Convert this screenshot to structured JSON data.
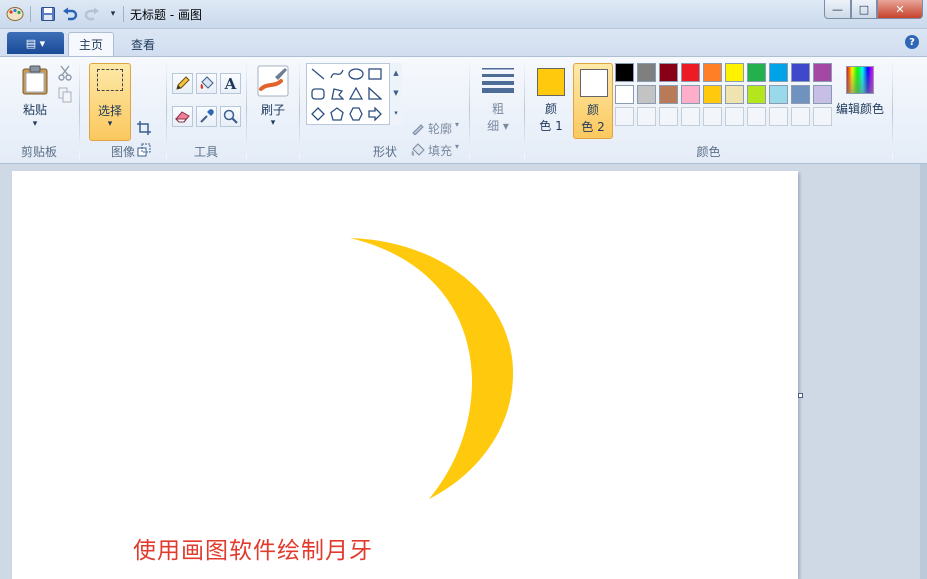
{
  "window": {
    "title": "无标题 - 画图",
    "controls": {
      "minimize": "—",
      "maximize": "□",
      "close": "✕"
    }
  },
  "quick_access": {
    "icons": [
      "paint-app-icon",
      "save-icon",
      "undo-icon",
      "redo-icon",
      "customize-dropdown-icon"
    ]
  },
  "tabs": {
    "app_menu": "▤ ▾",
    "home": "主页",
    "view": "查看",
    "help": "?"
  },
  "ribbon": {
    "clipboard": {
      "label": "剪贴板",
      "paste": "粘贴",
      "paste_arrow": "▾"
    },
    "image": {
      "label": "图像",
      "select": "选择",
      "select_arrow": "▾"
    },
    "tools": {
      "label": "工具"
    },
    "brushes": {
      "label": "刷子",
      "arrow": "▾"
    },
    "shapes": {
      "label": "形状",
      "outline": "轮廓",
      "fill": "填充"
    },
    "size": {
      "line1": "粗",
      "line2": "细 ▾"
    },
    "colors": {
      "label": "颜色",
      "color1_line1": "颜",
      "color1_line2": "色 1",
      "color2_line1": "颜",
      "color2_line2": "色 2",
      "color1_value": "#ffc90e",
      "color2_value": "#ffffff",
      "edit_colors": "编辑颜色",
      "palette_row1": [
        "#000000",
        "#7f7f7f",
        "#880015",
        "#ed1c24",
        "#ff7f27",
        "#fff200",
        "#22b14c",
        "#00a2e8",
        "#3f48cc",
        "#a349a4"
      ],
      "palette_row2": [
        "#ffffff",
        "#c3c3c3",
        "#b97a57",
        "#ffaec9",
        "#ffc90e",
        "#efe4b0",
        "#b5e61d",
        "#99d9ea",
        "#7092be",
        "#c8bfe7"
      ]
    }
  },
  "canvas": {
    "moon_color": "#ffc90e",
    "caption": "使用画图软件绘制月牙",
    "caption_color": "#e23b2d"
  }
}
